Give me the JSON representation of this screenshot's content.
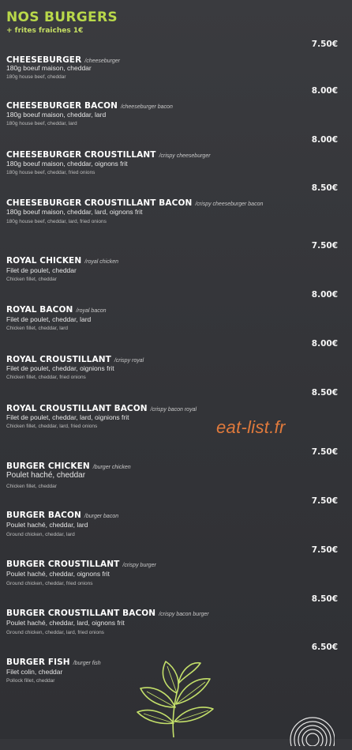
{
  "header": {
    "title": "NOS BURGERS",
    "subtitle": "+ frites fraiches 1€"
  },
  "watermark": "eat-list.fr",
  "items": [
    {
      "price": "7.50€",
      "name": "CHEESEBURGER",
      "alt": "/cheeseburger",
      "fr": "180g boeuf maison, cheddar",
      "en": "180g house beef, cheddar"
    },
    {
      "price": "8.00€",
      "name": "CHEESEBURGER BACON",
      "alt": "/cheeseburger bacon",
      "fr": "180g boeuf maison, cheddar, lard",
      "en": "180g house beef, cheddar, lard"
    },
    {
      "price": "8.00€",
      "name": "CHEESEBURGER CROUSTILLANT",
      "alt": "/crispy cheeseburger",
      "fr": "180g boeuf maison, cheddar, oignons frit",
      "en": "180g house beef, cheddar, fried onions"
    },
    {
      "price": "8.50€",
      "name": "CHEESEBURGER CROUSTILLANT BACON",
      "alt": "/crispy cheeseburger bacon",
      "fr": "180g boeuf maison, cheddar, lard, oignons frit",
      "en": "180g house beef, cheddar, lard, fried onions"
    },
    {
      "price": "7.50€",
      "name": "ROYAL CHICKEN",
      "alt": "/royal chicken",
      "fr": "Filet de poulet, cheddar",
      "en": "Chicken fillet, cheddar"
    },
    {
      "price": "8.00€",
      "name": "ROYAL BACON",
      "alt": "/royal bacon",
      "fr": "Filet de poulet, cheddar, lard",
      "en": "Chicken fillet, cheddar, lard"
    },
    {
      "price": "8.00€",
      "name": "ROYAL CROUSTILLANT",
      "alt": "/crispy royal",
      "fr": "Filet de poulet, cheddar, oignions frit",
      "en": "Chicken fillet, cheddar, fried onions"
    },
    {
      "price": "8.50€",
      "name": "ROYAL CROUSTILLANT BACON",
      "alt": "/crispy bacon royal",
      "fr": "Filet de poulet, cheddar, lard, oignions frit",
      "en": "Chicken fillet, cheddar,  lard, fried onions"
    },
    {
      "price": "7.50€",
      "name": "BURGER CHICKEN",
      "alt": "/burger chicken",
      "fr": "Poulet haché, cheddar",
      "en": "Chicken fillet, cheddar"
    },
    {
      "price": "7.50€",
      "name": "BURGER BACON",
      "alt": "/burger bacon",
      "fr": "Poulet haché, cheddar, lard",
      "en": "Ground chicken, cheddar, lard"
    },
    {
      "price": "7.50€",
      "name": "BURGER CROUSTILLANT",
      "alt": "/crispy burger",
      "fr": "Poulet haché, cheddar, oignons frit",
      "en": "Ground chicken, cheddar, fried onions"
    },
    {
      "price": "8.50€",
      "name": "BURGER CROUSTILLANT BACON",
      "alt": "/crispy bacon burger",
      "fr": "Poulet haché, cheddar, lard, oignons frit",
      "en": "Ground chicken, cheddar, lard, fried onions"
    },
    {
      "price": "6.50€",
      "name": "BURGER FISH",
      "alt": "/burger fish",
      "fr": "Filet colin, cheddar",
      "en": "Pollock fillet, cheddar"
    }
  ],
  "colors": {
    "background": "#35363a",
    "accent_green": "#b9d84a",
    "watermark_orange": "#e07a3c"
  },
  "decor": {
    "leaf_icon": "basil-leaf-icon",
    "logo_icon": "fingerprint-logo-icon"
  }
}
